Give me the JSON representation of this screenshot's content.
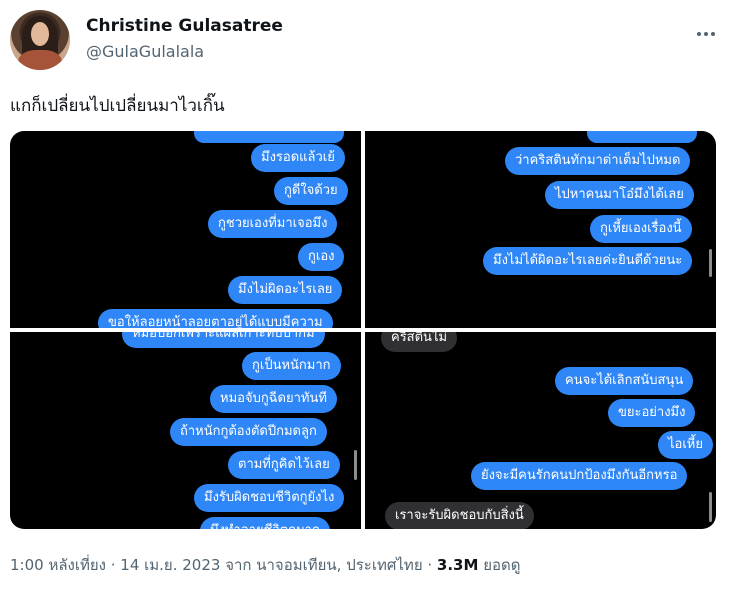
{
  "author": {
    "name": "Christine Gulasatree",
    "handle": "@GulaGulalala"
  },
  "tweet": {
    "text": "แกก็เปลี่ยนไปเปลี่ยนมาไวเกิ๊น"
  },
  "media": {
    "panel1": [
      "มึงรอดแล้วเย้",
      "กูดีใจด้วย",
      "กูชวยเองที่มาเจอมึง",
      "กูเอง",
      "มึงไม่ผิดอะไรเลย",
      "ขอให้ลอยหน้าลอยตาอยู่ได้แบบมีความ"
    ],
    "panel2": [
      "ว่าคริสตินทักมาด่าเต็มไปหมด",
      "ไปหาคนมาโอ๋มึงได้เลย",
      "กูเหี้ยเองเรื่องนี้",
      "มึงไม่ได้ผิดอะไรเลยค่ะยินดีด้วยนะ"
    ],
    "panel3": [
      "หมอบอกเพราะแผลเกาะทับปากม",
      "กูเป็นหนักมาก",
      "หมอจับกูฉีดยาทันที",
      "ถ้าหนักกูต้องตัดปีกมดลูก",
      "ตามที่กูคิดไว้เลย",
      "มึงรับผิดชอบชีวิตกูยังไง",
      "มึงทำลายชีวิตกูมาก"
    ],
    "panel4_gray_top": "คริสตินไม่",
    "panel4": [
      "คนจะได้เลิกสนับสนุน",
      "ขยะอย่างมึง",
      "ไอเหี้ย",
      "ยังจะมีคนรักคนปกป้องมึงกันอีกหรอ"
    ],
    "panel4_gray_bottom": "เราจะรับผิดชอบกับสิ่งนี้"
  },
  "meta": {
    "time": "1:00 หลังเที่ยง · 14 เม.ย. 2023 จาก นาจอมเทียน, ประเทศไทย · ",
    "views": "3.3M",
    "views_label": " ยอดดู"
  }
}
